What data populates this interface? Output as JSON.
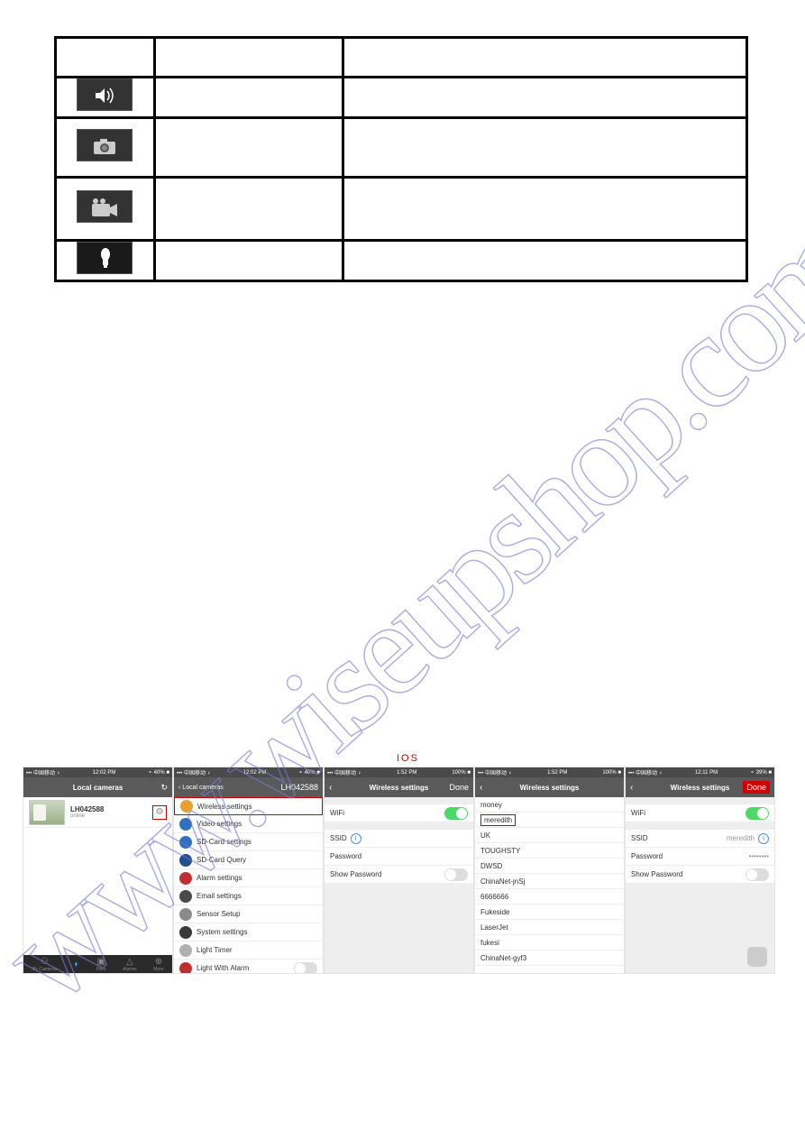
{
  "ios_label": "IOS",
  "screen1": {
    "carrier": "••• 中国移动 ♀",
    "time": "12:02 PM",
    "battery": "⚬ 40% ■",
    "title": "Local cameras",
    "refresh": "↻",
    "camera_id": "LH042588",
    "camera_status": "online",
    "tabs": [
      "My Cameras",
      "",
      "Files",
      "Alarms",
      "More"
    ]
  },
  "screen2": {
    "carrier": "••• 中国移动 ♀",
    "time": "12:02 PM",
    "battery": "⚬ 40% ■",
    "back": "‹ Local cameras",
    "title": "LH042588",
    "items": [
      {
        "label": "Wireless settings",
        "color": "#e8a030"
      },
      {
        "label": "Video settings",
        "color": "#3070c0"
      },
      {
        "label": "SD-Card settings",
        "color": "#3070c0"
      },
      {
        "label": "SD-Card Query",
        "color": "#205090"
      },
      {
        "label": "Alarm settings",
        "color": "#c03030"
      },
      {
        "label": "Email settings",
        "color": "#4a4a4a"
      },
      {
        "label": "Sensor Setup",
        "color": "#8a8a8a"
      },
      {
        "label": "System settings",
        "color": "#3a3a3a"
      },
      {
        "label": "Light Timer",
        "color": "#b0b0b0"
      },
      {
        "label": "Light With Alarm",
        "color": "#c03030"
      }
    ]
  },
  "screen3": {
    "carrier": "••• 中国移动 ♀",
    "time": "1:52 PM",
    "battery": "100% ■",
    "back": "‹",
    "title": "Wireless settings",
    "done": "Done",
    "wifi": "WiFi",
    "ssid": "SSID",
    "password": "Password",
    "show_pw": "Show Password"
  },
  "screen4": {
    "carrier": "••• 中国移动 ♀",
    "time": "1:52 PM",
    "battery": "100% ■",
    "back": "‹",
    "title": "Wireless settings",
    "networks": [
      "money",
      "meredith",
      "UK",
      "TOUGHSTY",
      "DWSD",
      "ChinaNet-jnSj",
      "6666666",
      "Fukeside",
      "LaserJet",
      "fukesi",
      "ChinaNet-gyf3"
    ]
  },
  "screen5": {
    "carrier": "••• 中国移动 ♀",
    "time": "12:11 PM",
    "battery": "⚬ 39% ■",
    "back": "‹",
    "title": "Wireless settings",
    "done": "Done",
    "wifi": "WiFi",
    "ssid": "SSID",
    "ssid_val": "meredith",
    "password": "Password",
    "password_val": "••••••••",
    "show_pw": "Show Password"
  }
}
